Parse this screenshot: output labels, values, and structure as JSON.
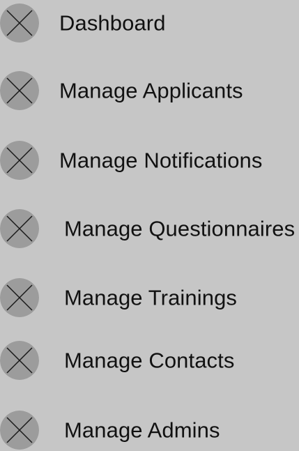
{
  "colors": {
    "background": "#c6c6c6",
    "icon_fill": "#9c9c9c",
    "icon_stroke": "#1a1a1a",
    "text": "#111111"
  },
  "menu": {
    "items": [
      {
        "label": "Dashboard",
        "icon": "image-placeholder-icon"
      },
      {
        "label": "Manage Applicants",
        "icon": "image-placeholder-icon"
      },
      {
        "label": "Manage Notifications",
        "icon": "image-placeholder-icon"
      },
      {
        "label": "Manage Questionnaires",
        "icon": "image-placeholder-icon"
      },
      {
        "label": "Manage Trainings",
        "icon": "image-placeholder-icon"
      },
      {
        "label": "Manage Contacts",
        "icon": "image-placeholder-icon"
      },
      {
        "label": "Manage Admins",
        "icon": "image-placeholder-icon"
      }
    ]
  }
}
